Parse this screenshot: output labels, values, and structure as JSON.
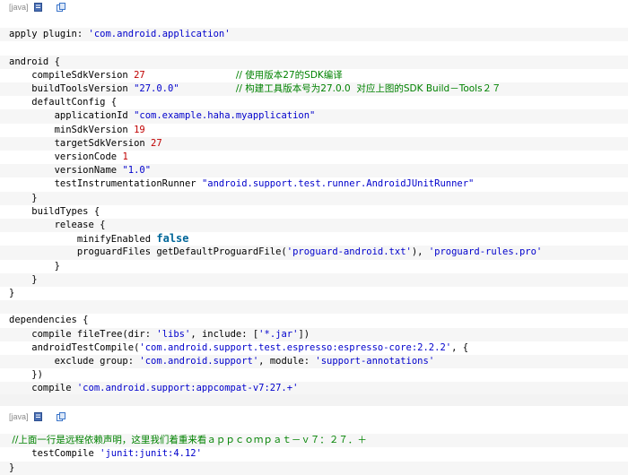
{
  "block1": {
    "tag": "[java]",
    "lines": [
      [
        {
          "t": "",
          "c": "plain"
        }
      ],
      [
        {
          "t": "apply plugin: ",
          "c": "plain"
        },
        {
          "t": "'com.android.application'",
          "c": "str"
        }
      ],
      [
        {
          "t": "",
          "c": "plain"
        }
      ],
      [
        {
          "t": "android {",
          "c": "plain"
        }
      ],
      [
        {
          "t": "    compileSdkVersion ",
          "c": "plain"
        },
        {
          "t": "27",
          "c": "num"
        },
        {
          "t": "                ",
          "c": "plain"
        },
        {
          "t": "// 使用版本27的SDK编译",
          "c": "cmt"
        }
      ],
      [
        {
          "t": "    buildToolsVersion ",
          "c": "plain"
        },
        {
          "t": "\"27.0.0\"",
          "c": "str"
        },
        {
          "t": "          ",
          "c": "plain"
        },
        {
          "t": "// 构建工具版本号为27.0.0  对应上图的SDK Build－Tools２７",
          "c": "cmt"
        }
      ],
      [
        {
          "t": "    defaultConfig {",
          "c": "plain"
        }
      ],
      [
        {
          "t": "        applicationId ",
          "c": "plain"
        },
        {
          "t": "\"com.example.haha.myapplication\"",
          "c": "str"
        }
      ],
      [
        {
          "t": "        minSdkVersion ",
          "c": "plain"
        },
        {
          "t": "19",
          "c": "num"
        }
      ],
      [
        {
          "t": "        targetSdkVersion ",
          "c": "plain"
        },
        {
          "t": "27",
          "c": "num"
        }
      ],
      [
        {
          "t": "        versionCode ",
          "c": "plain"
        },
        {
          "t": "1",
          "c": "num"
        }
      ],
      [
        {
          "t": "        versionName ",
          "c": "plain"
        },
        {
          "t": "\"1.0\"",
          "c": "str"
        }
      ],
      [
        {
          "t": "        testInstrumentationRunner ",
          "c": "plain"
        },
        {
          "t": "\"android.support.test.runner.AndroidJUnitRunner\"",
          "c": "str"
        }
      ],
      [
        {
          "t": "    }",
          "c": "plain"
        }
      ],
      [
        {
          "t": "    buildTypes {",
          "c": "plain"
        }
      ],
      [
        {
          "t": "        release {",
          "c": "plain"
        }
      ],
      [
        {
          "t": "            minifyEnabled ",
          "c": "plain"
        },
        {
          "t": "false",
          "c": "kw"
        }
      ],
      [
        {
          "t": "            proguardFiles getDefaultProguardFile(",
          "c": "plain"
        },
        {
          "t": "'proguard-android.txt'",
          "c": "str"
        },
        {
          "t": "), ",
          "c": "plain"
        },
        {
          "t": "'proguard-rules.pro'",
          "c": "str"
        }
      ],
      [
        {
          "t": "        }",
          "c": "plain"
        }
      ],
      [
        {
          "t": "    }",
          "c": "plain"
        }
      ],
      [
        {
          "t": "}",
          "c": "plain"
        }
      ],
      [
        {
          "t": "",
          "c": "plain"
        }
      ],
      [
        {
          "t": "dependencies {",
          "c": "plain"
        }
      ],
      [
        {
          "t": "    compile fileTree(dir: ",
          "c": "plain"
        },
        {
          "t": "'libs'",
          "c": "str"
        },
        {
          "t": ", include: [",
          "c": "plain"
        },
        {
          "t": "'*.jar'",
          "c": "str"
        },
        {
          "t": "])",
          "c": "plain"
        }
      ],
      [
        {
          "t": "    androidTestCompile(",
          "c": "plain"
        },
        {
          "t": "'com.android.support.test.espresso:espresso-core:2.2.2'",
          "c": "str"
        },
        {
          "t": ", {",
          "c": "plain"
        }
      ],
      [
        {
          "t": "        exclude group: ",
          "c": "plain"
        },
        {
          "t": "'com.android.support'",
          "c": "str"
        },
        {
          "t": ", module: ",
          "c": "plain"
        },
        {
          "t": "'support-annotations'",
          "c": "str"
        }
      ],
      [
        {
          "t": "    })",
          "c": "plain"
        }
      ],
      [
        {
          "t": "    compile ",
          "c": "plain"
        },
        {
          "t": "'com.android.support:appcompat-v7:27.+'",
          "c": "str"
        }
      ]
    ]
  },
  "block2": {
    "tag": "[java]",
    "lines": [
      [
        {
          "t": "",
          "c": "plain"
        }
      ],
      [
        {
          "t": " //上面一行是远程依赖声明，这里我们着重来看ａｐｐｃｏｍｐａｔ－ｖ７：２７．＋",
          "c": "cmt"
        }
      ],
      [
        {
          "t": "    testCompile ",
          "c": "plain"
        },
        {
          "t": "'junit:junit:4.12'",
          "c": "str"
        }
      ],
      [
        {
          "t": "}",
          "c": "plain"
        }
      ]
    ]
  },
  "icons": [
    "view-source-icon",
    "copy-icon"
  ],
  "colors": {
    "string": "#0000cc",
    "number": "#c00000",
    "comment": "#008200",
    "keyword": "#006699",
    "alt_row": "#f6f6f6"
  }
}
